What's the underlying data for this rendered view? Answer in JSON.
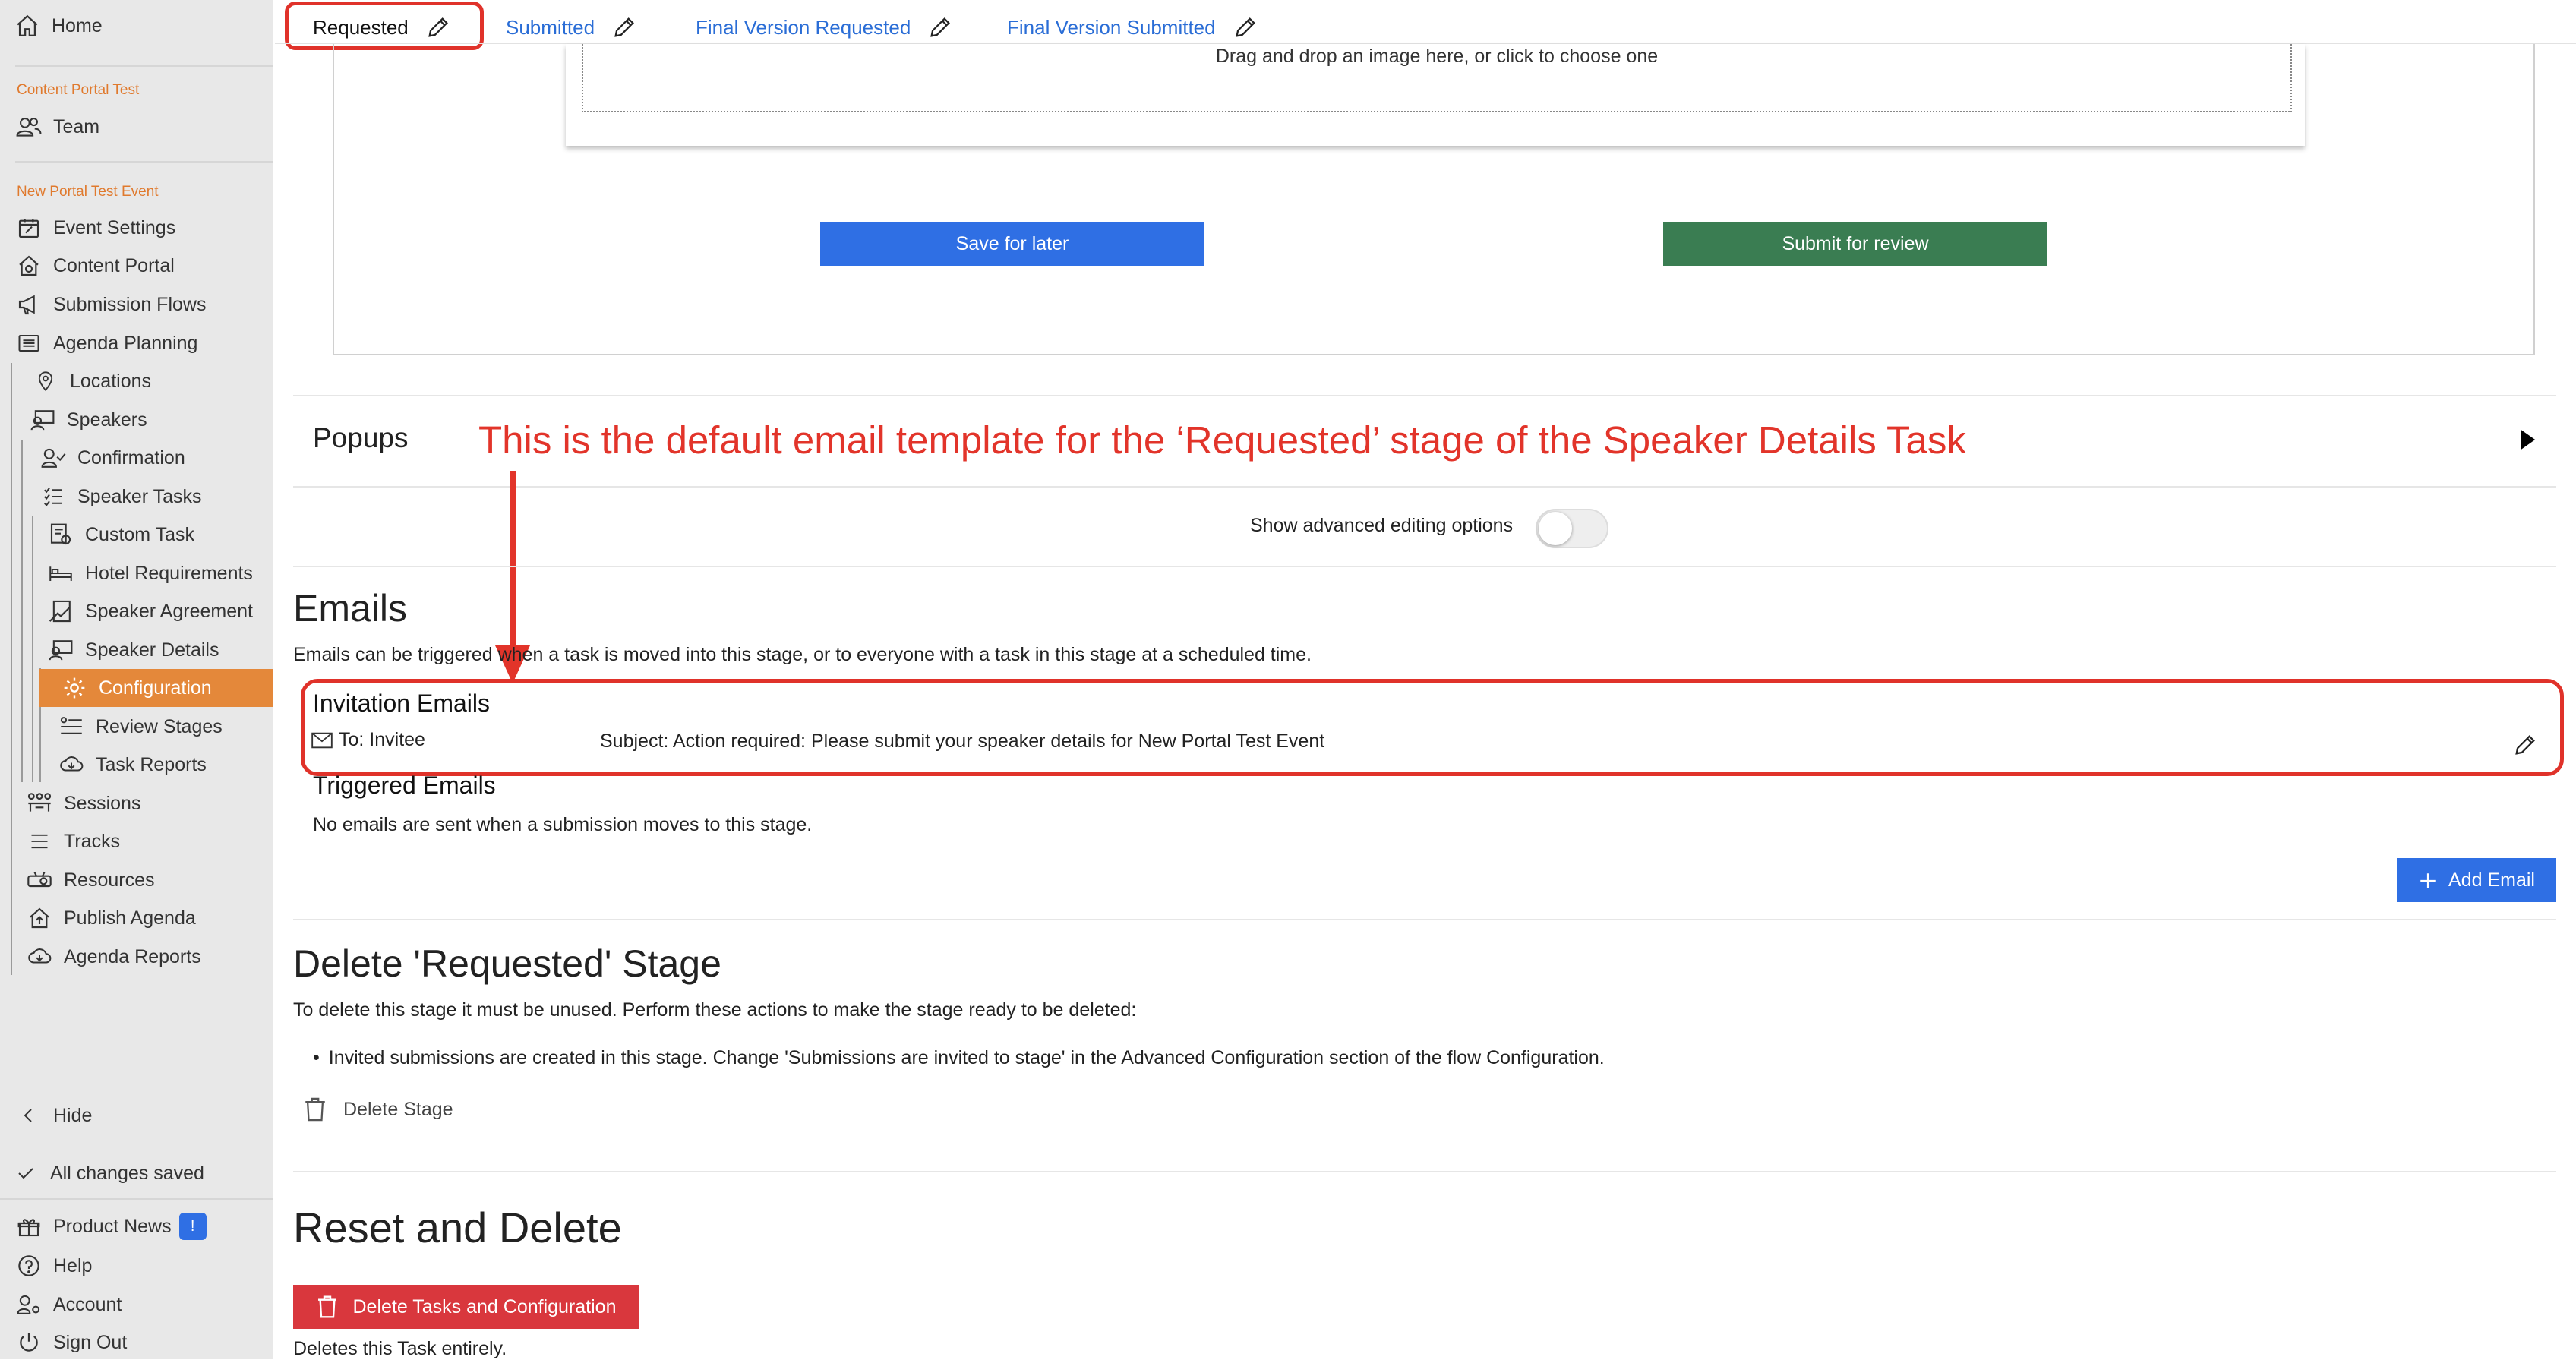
{
  "sidebar": {
    "home": "Home",
    "section1": "Content Portal Test",
    "team": "Team",
    "section2": "New Portal Test Event",
    "event_settings": "Event Settings",
    "content_portal": "Content Portal",
    "submission_flows": "Submission Flows",
    "agenda_planning": "Agenda Planning",
    "locations": "Locations",
    "speakers": "Speakers",
    "confirmation": "Confirmation",
    "speaker_tasks": "Speaker Tasks",
    "custom_task": "Custom Task",
    "hotel_requirements": "Hotel Requirements",
    "speaker_agreement": "Speaker Agreement",
    "speaker_details": "Speaker Details",
    "configuration": "Configuration",
    "review_stages": "Review Stages",
    "task_reports": "Task Reports",
    "sessions": "Sessions",
    "tracks": "Tracks",
    "resources": "Resources",
    "publish_agenda": "Publish Agenda",
    "agenda_reports": "Agenda Reports",
    "hide": "Hide",
    "saved": "All changes saved",
    "product_news": "Product News",
    "product_news_badge": "!",
    "help": "Help",
    "account": "Account",
    "sign_out": "Sign Out"
  },
  "tabs": [
    "Requested",
    "Submitted",
    "Final Version Requested",
    "Final Version Submitted"
  ],
  "upload": {
    "drop_text": "Drag and drop an image here, or click to choose one",
    "save_label": "Save for later",
    "submit_label": "Submit for review"
  },
  "popups": {
    "title": "Popups",
    "annotation": "This is the default email template for the ‘Requested’ stage of the Speaker Details Task"
  },
  "advanced": {
    "label": "Show advanced editing options",
    "enabled": false
  },
  "emails": {
    "title": "Emails",
    "desc": "Emails can be triggered when a task is moved into this stage, or to everyone with a task in this stage at a scheduled time.",
    "invitation_title": "Invitation Emails",
    "to": "To: Invitee",
    "subject": "Subject: Action required: Please submit your speaker details for New Portal Test Event",
    "triggered_title": "Triggered Emails",
    "triggered_none": "No emails are sent when a submission moves to this stage.",
    "add_email": "Add Email"
  },
  "delete_stage": {
    "title": "Delete 'Requested' Stage",
    "desc": "To delete this stage it must be unused. Perform these actions to make the stage ready to be deleted:",
    "bullet": "Invited submissions are created in this stage. Change 'Submissions are invited to stage' in the Advanced Configuration section of the flow Configuration.",
    "button": "Delete Stage"
  },
  "reset": {
    "title": "Reset and Delete",
    "button": "Delete Tasks and Configuration",
    "note": "Deletes this Task entirely."
  },
  "colors": {
    "accent_orange": "#e4883a",
    "blue_button": "#2f6fe4",
    "green_button": "#3a7d52",
    "red_button": "#d9373d",
    "annotation_red": "#e2342a",
    "link_blue": "#2a6dd6"
  }
}
